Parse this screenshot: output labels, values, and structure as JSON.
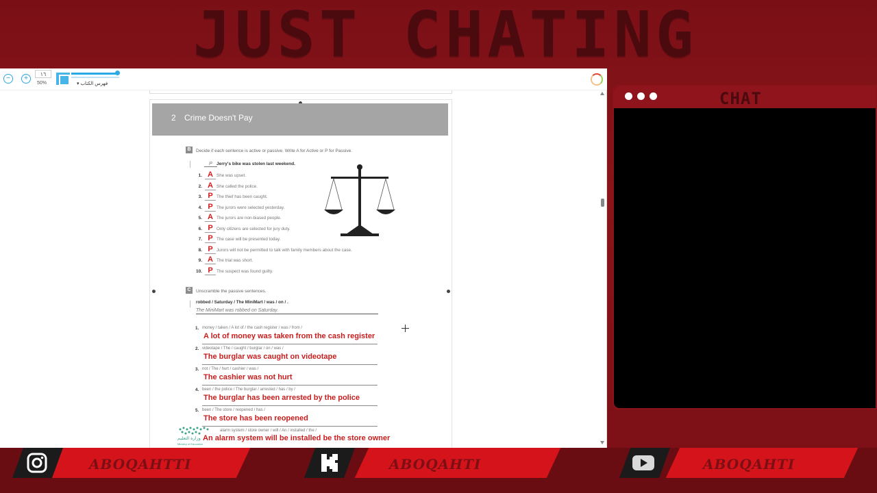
{
  "overlay": {
    "banner_title": "JUST CHATING",
    "chat_title": "CHAT"
  },
  "toolbar": {
    "zoom_out_icon": "minus-circle-icon",
    "zoom_in_icon": "plus-circle-icon",
    "page_number": "١٦",
    "zoom_level": "50%",
    "fit_icon": "fit-page-icon",
    "toc_label": "▾ فهرس الكتاب",
    "accent": "#29a9e6"
  },
  "document": {
    "chapter_number": "2",
    "chapter_title": "Crime Doesn't Pay",
    "section_b": {
      "mark": "B",
      "instruction": "Decide if each sentence is active or passive. Write A for Active or P for Passive.",
      "example_answer": "P",
      "example_sentence": "Jerry's bike was stolen last weekend.",
      "items": [
        {
          "num": "1.",
          "answer": "A",
          "text": "She was upset."
        },
        {
          "num": "2.",
          "answer": "A",
          "text": "She called the police."
        },
        {
          "num": "3.",
          "answer": "P",
          "text": "The thief has been caught."
        },
        {
          "num": "4.",
          "answer": "P",
          "text": "The jurors were selected yesterday."
        },
        {
          "num": "5.",
          "answer": "A",
          "text": "The jurors are non-biased people."
        },
        {
          "num": "6.",
          "answer": "P",
          "text": "Only citizens are selected for jury duty."
        },
        {
          "num": "7.",
          "answer": "P",
          "text": "The case will be presented today."
        },
        {
          "num": "8.",
          "answer": "P",
          "text": "Jurors will not be permitted to talk with family members about the case."
        },
        {
          "num": "9.",
          "answer": "A",
          "text": "The trial was short."
        },
        {
          "num": "10.",
          "answer": "P",
          "text": "The suspect was found guilty."
        }
      ]
    },
    "section_c": {
      "mark": "C",
      "instruction": "Unscramble the passive sentences.",
      "example_words": "robbed / Saturday / The MiniMart / was / on / .",
      "example_answer": "The MiniMart was robbed on Saturday.",
      "items": [
        {
          "num": "1.",
          "words": "money / taken / A lot of  / the cash register / was / from /",
          "answer": "A lot of money was taken from the cash register"
        },
        {
          "num": "2.",
          "words": "videotape / The / caught / burglar / on / was /",
          "answer": "The burglar was caught on videotape"
        },
        {
          "num": "3.",
          "words": "not / The / hurt / cashier / was /",
          "answer": "The cashier was not hurt"
        },
        {
          "num": "4.",
          "words": "been / the police / The burglar / arrested / has / by /",
          "answer": "The burglar has been arrested by the police"
        },
        {
          "num": "5.",
          "words": "been / The store / reopened / has /",
          "answer": "The store has been reopened"
        },
        {
          "num": "6.",
          "words": "alarm system / store owner / will / An / installed / the /",
          "answer": "An alarm system will be installed be the store owner"
        }
      ]
    },
    "logo": {
      "arabic": "وزارة التعليم",
      "english": "Ministry of Education"
    },
    "answer_color": "#d11b1b"
  },
  "bottom_bar": {
    "items": [
      {
        "icon": "instagram-icon",
        "handle": "ABOQAHTTI"
      },
      {
        "icon": "kick-icon",
        "handle": "ABOQAHTI"
      },
      {
        "icon": "youtube-icon",
        "handle": "ABOQAHTI"
      }
    ],
    "stripe_color": "#d5131b"
  }
}
